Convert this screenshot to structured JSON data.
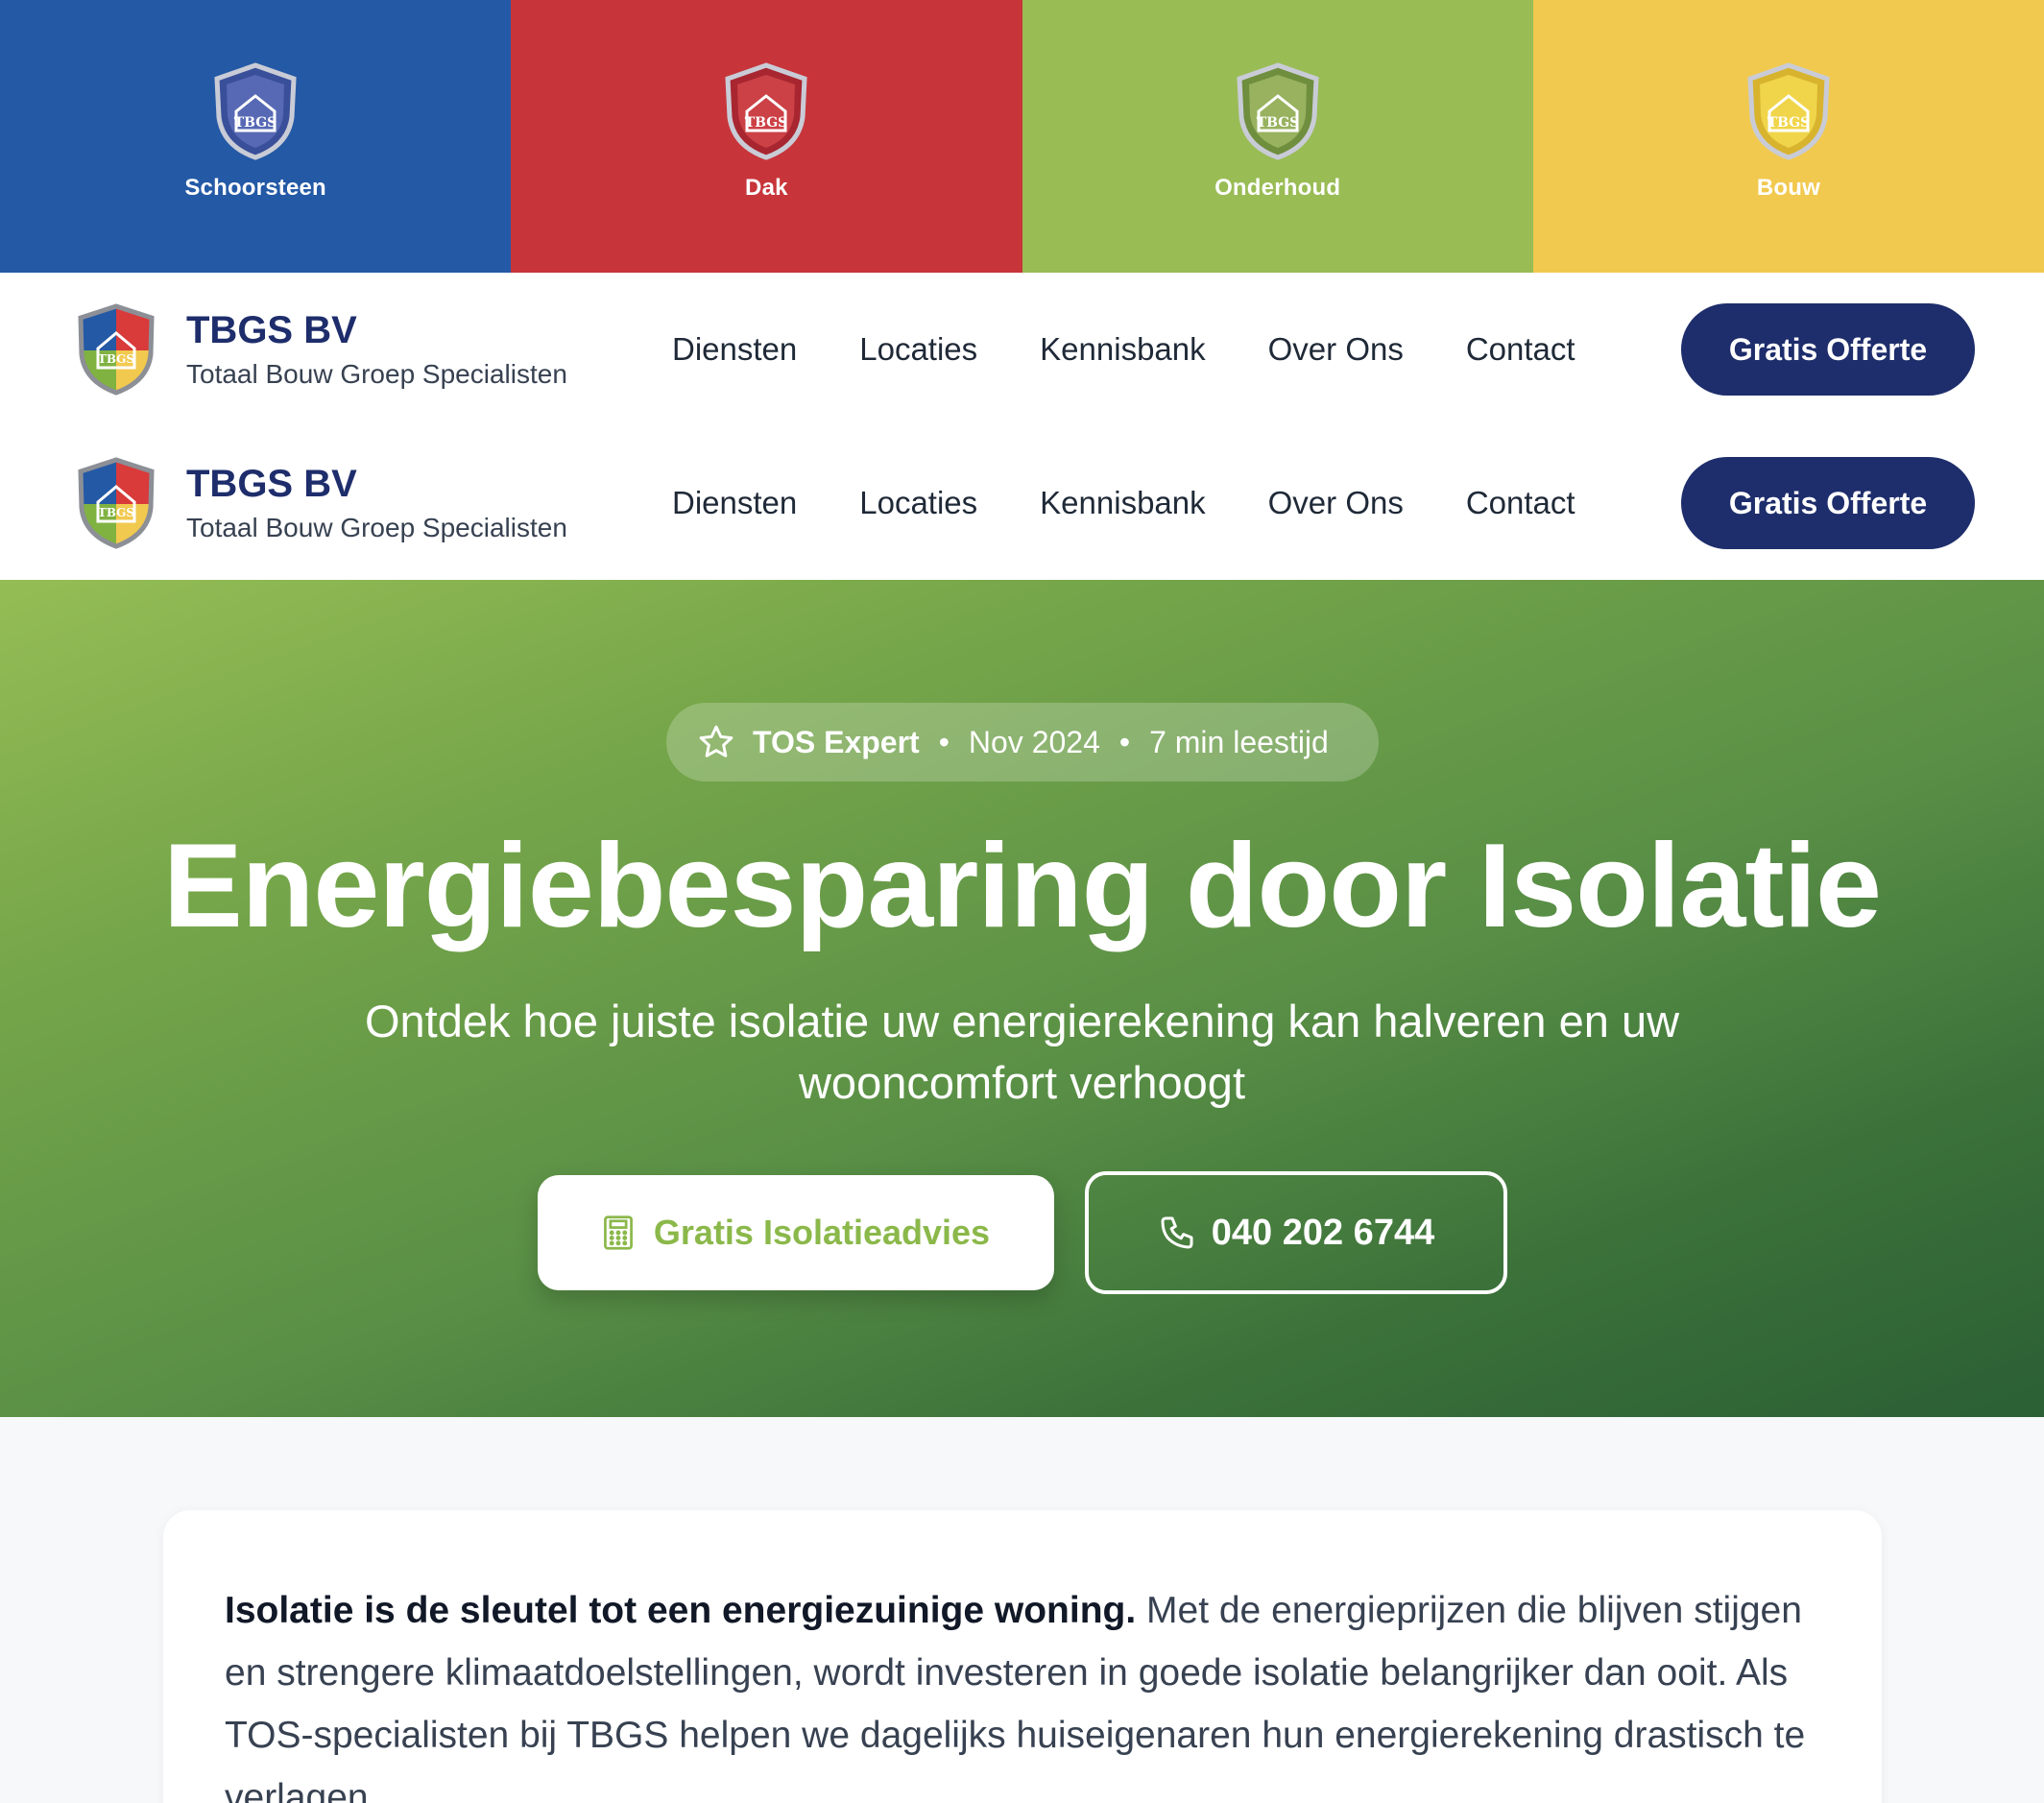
{
  "categories": [
    {
      "label": "Schoorsteen",
      "color": "#2459a6"
    },
    {
      "label": "Dak",
      "color": "#c7353a"
    },
    {
      "label": "Onderhoud",
      "color": "#99bc55"
    },
    {
      "label": "Bouw",
      "color": "#f2c94f"
    }
  ],
  "brand": {
    "name": "TBGS BV",
    "subtitle": "Totaal Bouw Groep Specialisten",
    "shield_text": "TBGS"
  },
  "nav": {
    "items": [
      "Diensten",
      "Locaties",
      "Kennisbank",
      "Over Ons",
      "Contact"
    ],
    "cta": "Gratis Offerte"
  },
  "hero": {
    "author": "TOS Expert",
    "date": "Nov 2024",
    "read_time": "7 min leestijd",
    "separator": "•",
    "title": "Energiebesparing door Isolatie",
    "subtitle": "Ontdek hoe juiste isolatie uw energierekening kan halveren en uw wooncomfort verhoogt",
    "primary_button": "Gratis Isolatieadvies",
    "phone_button": "040 202 6744"
  },
  "article": {
    "lead_bold": "Isolatie is de sleutel tot een energiezuinige woning.",
    "lead_text": " Met de energieprijzen die blijven stijgen en strengere klimaatdoelstellingen, wordt investeren in goede isolatie belangrijker dan ooit. Als TOS-specialisten bij TBGS helpen we dagelijks huiseigenaren hun energierekening drastisch te verlagen."
  },
  "colors": {
    "primary": "#1e2d6b",
    "accent_green": "#8bb84a",
    "hero_dark": "#2b5f35"
  },
  "icons": {
    "star": "star-icon",
    "calculator": "calculator-icon",
    "phone": "phone-icon",
    "shield": "shield-logo-icon"
  }
}
